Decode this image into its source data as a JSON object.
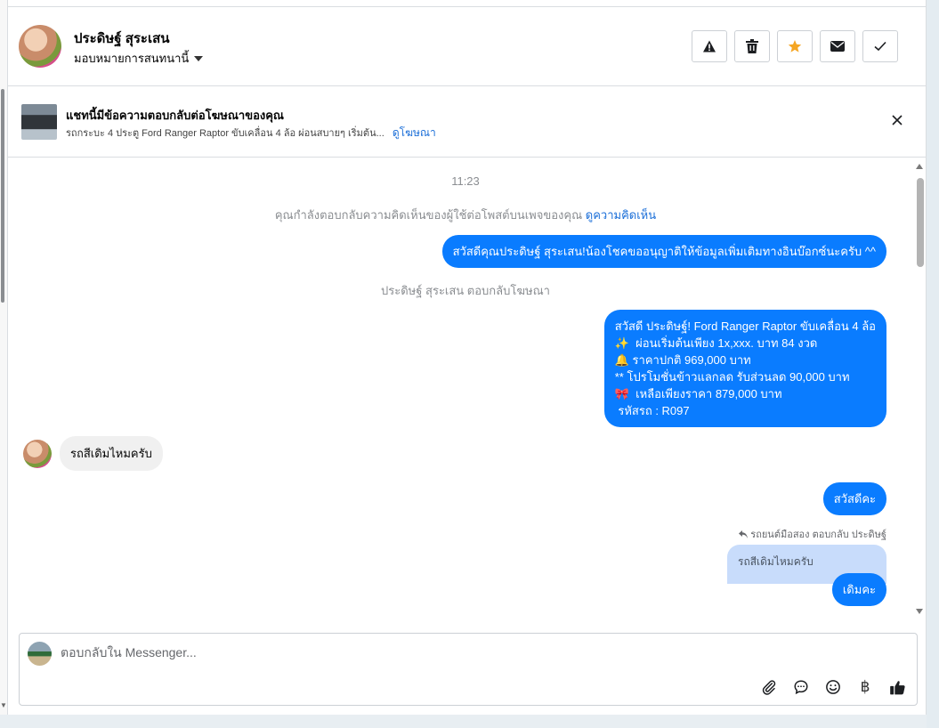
{
  "header": {
    "name": "ประดิษฐ์ สุระเสน",
    "assign_label": "มอบหมายการสนทนานี้",
    "actions": [
      {
        "name": "report-button",
        "icon": "warning-icon"
      },
      {
        "name": "delete-button",
        "icon": "trash-icon"
      },
      {
        "name": "star-button",
        "icon": "star-icon"
      },
      {
        "name": "mark-unread-button",
        "icon": "envelope-icon"
      },
      {
        "name": "mark-done-button",
        "icon": "check-icon"
      }
    ],
    "star_color": "#f5a623"
  },
  "ad": {
    "title": "แชทนี้มีข้อความตอบกลับต่อโฆษณาของคุณ",
    "subtitle": "รถกระบะ 4 ประตู Ford Ranger Raptor ขับเคลื่อน 4 ล้อ ผ่อนสบายๆ เริ่มต้น...",
    "link": "ดูโฆษณา"
  },
  "chat": {
    "time": "11:23",
    "system_comment": "คุณกำลังตอบกลับความคิดเห็นของผู้ใช้ต่อโพสต์บนเพจของคุณ",
    "system_comment_link": "ดูความคิดเห็น",
    "msg1": "สวัสดีคุณประดิษฐ์ สุระเสน!น้องโชคขออนุญาติให้ข้อมูลเพิ่มเติมทางอินบ๊อกซ์นะครับ ^^",
    "system_ad_reply": "ประดิษฐ์ สุระเสน ตอบกลับโฆษณา",
    "msg2": "สวัสดี ประดิษฐ์! Ford Ranger Raptor ขับเคลื่อน 4 ล้อ\n✨  ผ่อนเริ่มต้นเพียง 1x,xxx. บาท 84 งวด\n🔔 ราคาปกติ 969,000 บาท\n** โปรโมชั่นข้าวแลกลด รับส่วนลด 90,000 บาท\n🎀  เหลือเพียงราคา 879,000 บาท\n รหัสรถ : R097",
    "incoming1": "รถสีเดิมไหมครับ",
    "msg3": "สวัสดีคะ",
    "reply_note": "รถยนต์มือสอง ตอบกลับ ประดิษฐ์",
    "quoted": "รถสีเดิมไหมครับ",
    "msg4": "เดิมคะ",
    "brand_color": "#0a7cff"
  },
  "composer": {
    "placeholder": "ตอบกลับใน Messenger...",
    "tools": [
      "paperclip-icon",
      "chat-bubble-icon",
      "emoji-icon",
      "baht-icon",
      "thumbs-up-icon"
    ],
    "baht_symbol": "฿"
  }
}
